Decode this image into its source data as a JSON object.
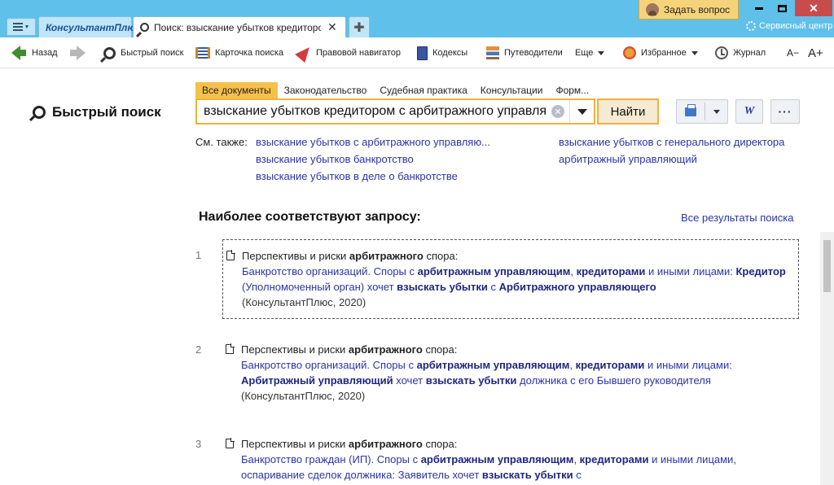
{
  "app": {
    "brand_tab": "КонсультантПлюс",
    "active_tab": "Поиск: взыскание убытков кредитором с арбитражного управляющего",
    "ask_question": "Задать вопрос",
    "service_center": "Сервисный центр"
  },
  "toolbar": {
    "back": "Назад",
    "quick_search": "Быстрый поиск",
    "search_card": "Карточка поиска",
    "legal_navigator": "Правовой навигатор",
    "codes": "Кодексы",
    "guides": "Путеводители",
    "more": "Еще",
    "favorites": "Избранное",
    "journal": "Журнал",
    "font_smaller": "A−",
    "font_larger": "A+"
  },
  "search": {
    "title": "Быстрый поиск",
    "tabs": [
      {
        "label": "Все документы"
      },
      {
        "label": "Законодательство"
      },
      {
        "label": "Судебная практика"
      },
      {
        "label": "Консультации"
      },
      {
        "label": "Форм..."
      }
    ],
    "query": "взыскание убытков кредитором с арбитражного управляющего",
    "find_button": "Найти",
    "word_button": "W",
    "more_button": "···"
  },
  "see_also": {
    "label": "См. также:",
    "links": [
      "взыскание убытков с арбитражного управляю...",
      "взыскание убытков банкротство",
      "взыскание убытков в деле о банкротстве",
      "взыскание убытков с генерального директора",
      "арбитражный управляющий"
    ]
  },
  "results": {
    "heading": "Наиболее соответствуют запросу:",
    "all_results": "Все результаты поиска",
    "items": [
      {
        "num": "1",
        "line1_plain": "Перспективы и риски ",
        "line1_bold": "арбитражного",
        "line1_end": " спора:",
        "p1": "Банкротство организаций. Споры с ",
        "b1": "арбитражным управляющим",
        "p2": ", ",
        "b2": "кредиторами",
        "p3": " и иными лицами: ",
        "b3": "Кредитор",
        "p4": " (Уполномоченный орган) хочет ",
        "b4": "взыскать убытки",
        "p5": " с ",
        "b5": "Арбитражного управляющего",
        "p6": "",
        "source": "(КонсультантПлюс, 2020)"
      },
      {
        "num": "2",
        "line1_plain": "Перспективы и риски ",
        "line1_bold": "арбитражного",
        "line1_end": " спора:",
        "p1": "Банкротство организаций. Споры с ",
        "b1": "арбитражным управляющим",
        "p2": ", ",
        "b2": "кредиторами",
        "p3": " и иными лицами: ",
        "b3": "Арбитражный управляющий",
        "p4": " хочет ",
        "b4": "взыскать убытки",
        "p5": " должника с его Бывшего руководителя",
        "b5": "",
        "p6": "",
        "source": "(КонсультантПлюс, 2020)"
      },
      {
        "num": "3",
        "line1_plain": "Перспективы и риски ",
        "line1_bold": "арбитражного",
        "line1_end": " спора:",
        "p1": "Банкротство граждан (ИП). Споры с ",
        "b1": "арбитражным управляющим",
        "p2": ", ",
        "b2": "кредиторами",
        "p3": " и иными лицами, оспаривание сделок должника: Заявитель хочет ",
        "b3": "",
        "p4": "",
        "b4": "взыскать убытки",
        "p5": " с",
        "b5": "",
        "p6": "",
        "source": ""
      }
    ]
  }
}
